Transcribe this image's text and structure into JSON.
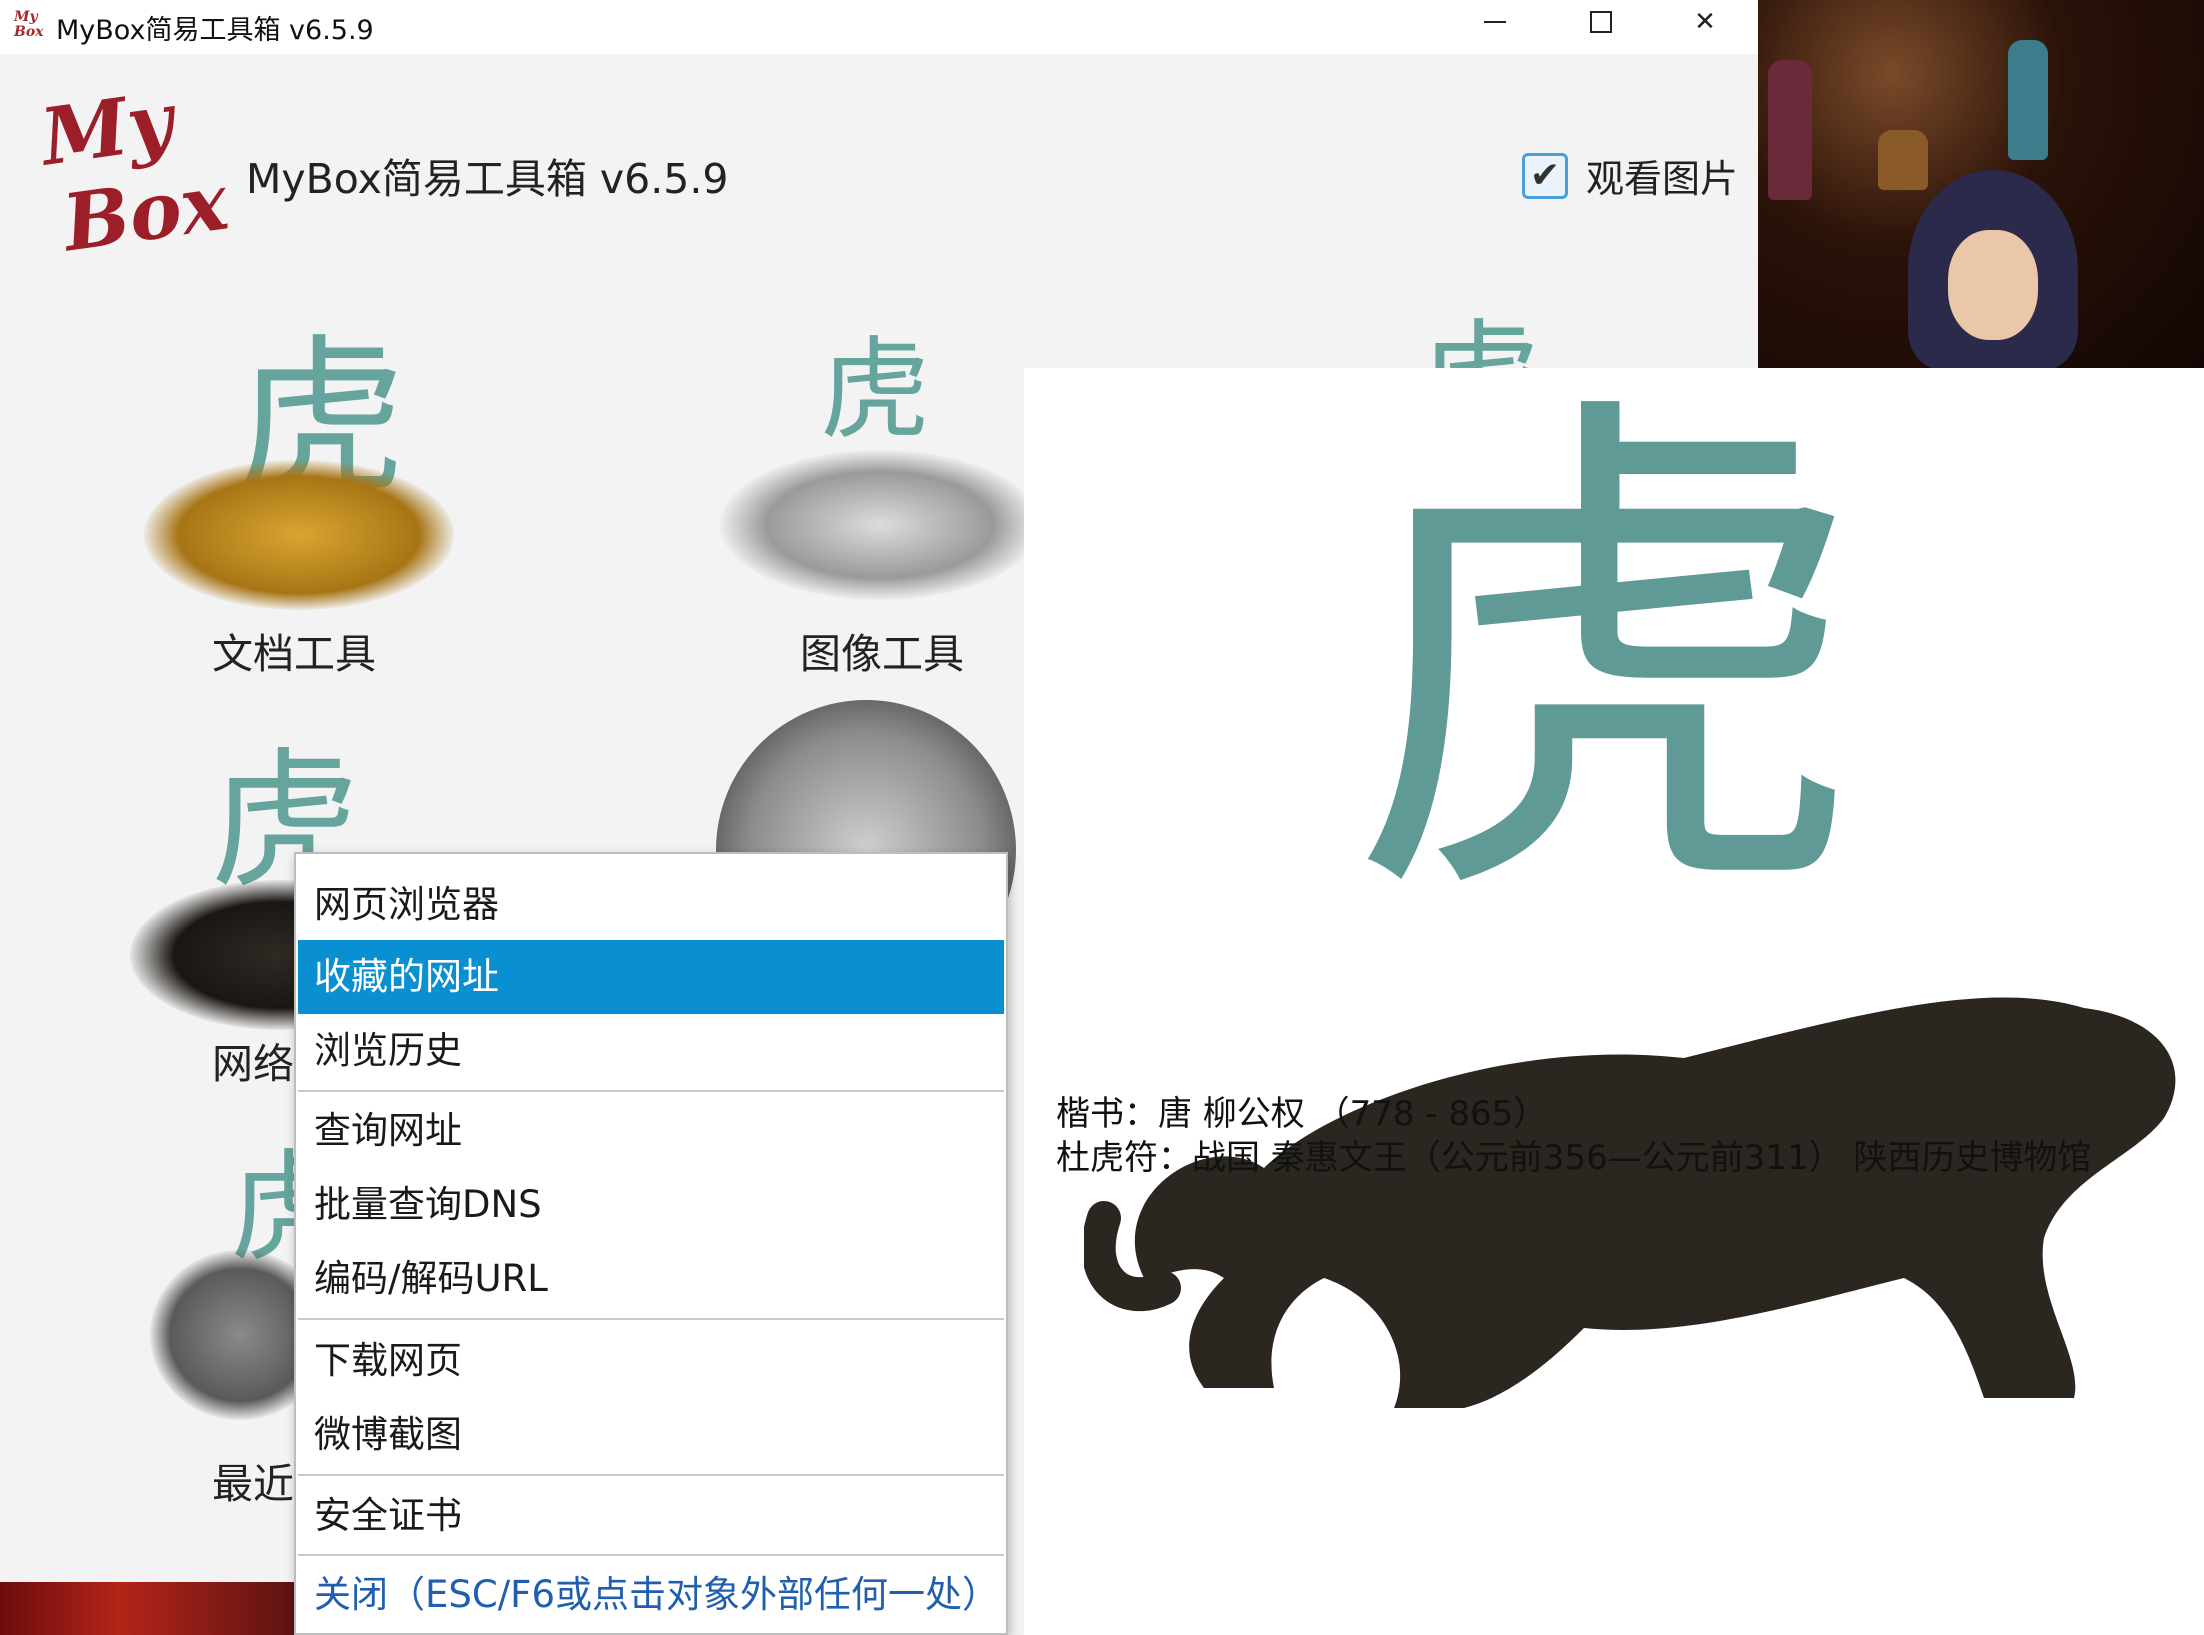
{
  "window": {
    "title": "MyBox简易工具箱 v6.5.9",
    "minimize_label": "—",
    "maximize_label": "☐",
    "close_label": "✕"
  },
  "header": {
    "logo_line1": "My",
    "logo_line2": "Box",
    "title": "MyBox简易工具箱 v6.5.9",
    "view_images_label": "观看图片",
    "view_images_checked": true
  },
  "tools": [
    {
      "label": "文档工具"
    },
    {
      "label": "图像工具"
    },
    {
      "label": "网络"
    },
    {
      "label": "最近"
    }
  ],
  "context_menu": {
    "items": [
      {
        "label": "网页浏览器",
        "selected": false
      },
      {
        "label": "收藏的网址",
        "selected": true
      },
      {
        "label": "浏览历史",
        "selected": false
      },
      {
        "label": "查询网址",
        "selected": false
      },
      {
        "label": "批量查询DNS",
        "selected": false
      },
      {
        "label": "编码/解码URL",
        "selected": false
      },
      {
        "label": "下载网页",
        "selected": false
      },
      {
        "label": "微博截图",
        "selected": false
      },
      {
        "label": "安全证书",
        "selected": false
      },
      {
        "label": "关闭（ESC/F6或点击对象外部任何一处）",
        "selected": false
      }
    ]
  },
  "image_popup": {
    "glyph": "虎",
    "caption_line1": "楷书：唐 柳公权 （778 - 865）",
    "caption_line2": "杜虎符：战国 秦惠文王（公元前356—公元前311） 陕西历史博物馆"
  },
  "colors": {
    "accent": "#0a8fd0",
    "glyph_teal": "#5f9a96",
    "logo_red": "#9b1e28",
    "close_link": "#1f5fae"
  }
}
